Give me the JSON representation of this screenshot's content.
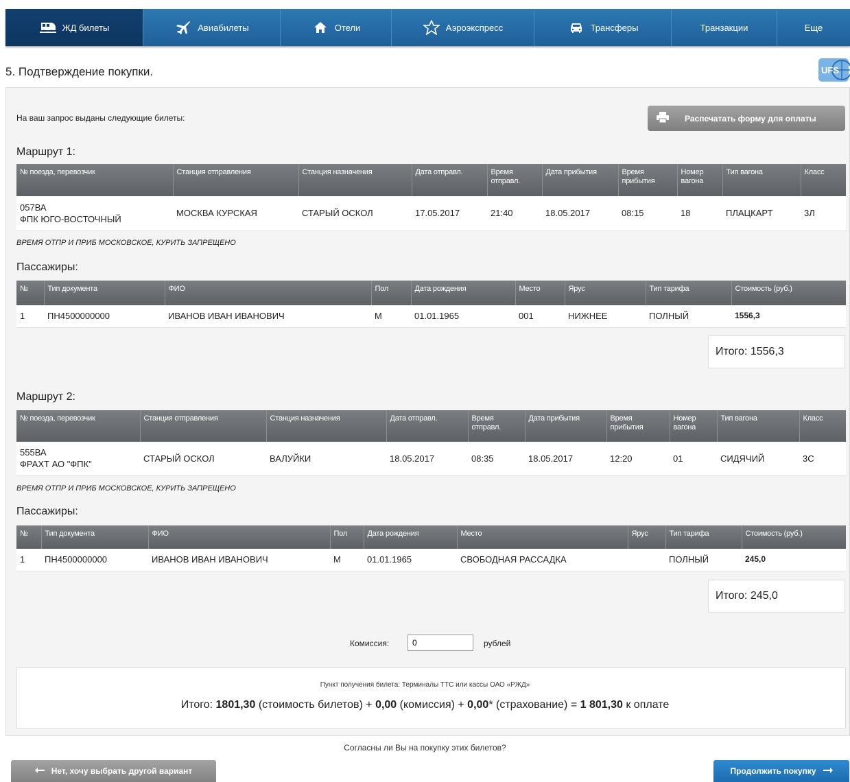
{
  "nav": {
    "rail": "ЖД билеты",
    "avia": "Авиабилеты",
    "hotels": "Отели",
    "aeroexpress": "Аэроэкспресс",
    "transfers": "Трансферы",
    "transactions": "Транзакции",
    "more": "Еще"
  },
  "page": {
    "heading": "5. Подтверждение покупки.",
    "logo_text": "UFS",
    "intro": "На ваш запрос выданы следующие билеты:",
    "print_button": "Распечатать форму для оплаты"
  },
  "route_headers": [
    "№ поезда, перевозчик",
    "Станция отправления",
    "Станция назначения",
    "Дата отправл.",
    "Время отправл.",
    "Дата прибытия",
    "Время прибытия",
    "Номер вагона",
    "Тип вагона",
    "Класс"
  ],
  "routes": [
    {
      "title": "Маршрут 1:",
      "train_number": "057ВА",
      "carrier": "ФПК ЮГО-ВОСТОЧНЫЙ",
      "from": "МОСКВА КУРСКАЯ",
      "to": "СТАРЫЙ ОСКОЛ",
      "dep_date": "17.05.2017",
      "dep_time": "21:40",
      "arr_date": "18.05.2017",
      "arr_time": "08:15",
      "car_number": "18",
      "car_type": "ПЛАЦКАРТ",
      "class": "3Л",
      "note": "ВРЕМЯ ОТПР И ПРИБ МОСКОВСКОЕ, КУРИТЬ ЗАПРЕЩЕНО",
      "passengers_title": "Пассажиры:",
      "passenger_headers": [
        "№",
        "Тип документа",
        "ФИО",
        "Пол",
        "Дата рождения",
        "Место",
        "Ярус",
        "Тип тарифа",
        "Стоимость (руб.)"
      ],
      "passenger": {
        "num": "1",
        "document": "ПН4500000000",
        "name": "ИВАНОВ ИВАН ИВАНОВИЧ",
        "sex": "М",
        "birth": "01.01.1965",
        "seat": "001",
        "tier": "НИЖНЕЕ",
        "tariff": "ПОЛНЫЙ",
        "cost": "1556,3"
      },
      "total": "Итого: 1556,3"
    },
    {
      "title": "Маршрут 2:",
      "train_number": "555ВА",
      "carrier": "ФРАХТ АО \"ФПК\"",
      "from": "СТАРЫЙ ОСКОЛ",
      "to": "ВАЛУЙКИ",
      "dep_date": "18.05.2017",
      "dep_time": "08:35",
      "arr_date": "18.05.2017",
      "arr_time": "12:20",
      "car_number": "01",
      "car_type": "СИДЯЧИЙ",
      "class": "3С",
      "note": "ВРЕМЯ ОТПР И ПРИБ МОСКОВСКОЕ, КУРИТЬ ЗАПРЕЩЕНО",
      "passengers_title": "Пассажиры:",
      "passenger_headers": [
        "№",
        "Тип документа",
        "ФИО",
        "Пол",
        "Дата рождения",
        "Место",
        "Ярус",
        "Тип тарифа",
        "Стоимость (руб.)"
      ],
      "passenger": {
        "num": "1",
        "document": "ПН4500000000",
        "name": "ИВАНОВ ИВАН ИВАНОВИЧ",
        "sex": "М",
        "birth": "01.01.1965",
        "seat": "СВОБОДНАЯ РАССАДКА",
        "tier": "",
        "tariff": "ПОЛНЫЙ",
        "cost": "245,0"
      },
      "total": "Итого: 245,0"
    }
  ],
  "commission": {
    "label": "Комиссия:",
    "value": "0",
    "unit": "рублей"
  },
  "summary": {
    "pickup": "Пункт получения билета: Терминалы ТТС или кассы ОАО «РЖД»",
    "prefix": "Итого:",
    "tickets_value": "1801,30",
    "tickets_label": "(стоимость билетов) +",
    "commission_value": "0,00",
    "commission_label": "(комиссия) +",
    "insurance_value": "0,00",
    "insurance_label": "* (страхование) =",
    "total_value": "1 801,30",
    "total_label": "к оплате"
  },
  "footer": {
    "question": "Согласны ли Вы на покупку этих билетов?",
    "back_button": "Нет, хочу выбрать другой вариант",
    "next_button": "Продолжить покупку"
  },
  "colors": {
    "nav": "#1f5f99",
    "nav_active": "#0d3560",
    "table_header": "#676b6f",
    "primary_button": "#1c6cb0",
    "secondary_button": "#8f8f8f"
  }
}
